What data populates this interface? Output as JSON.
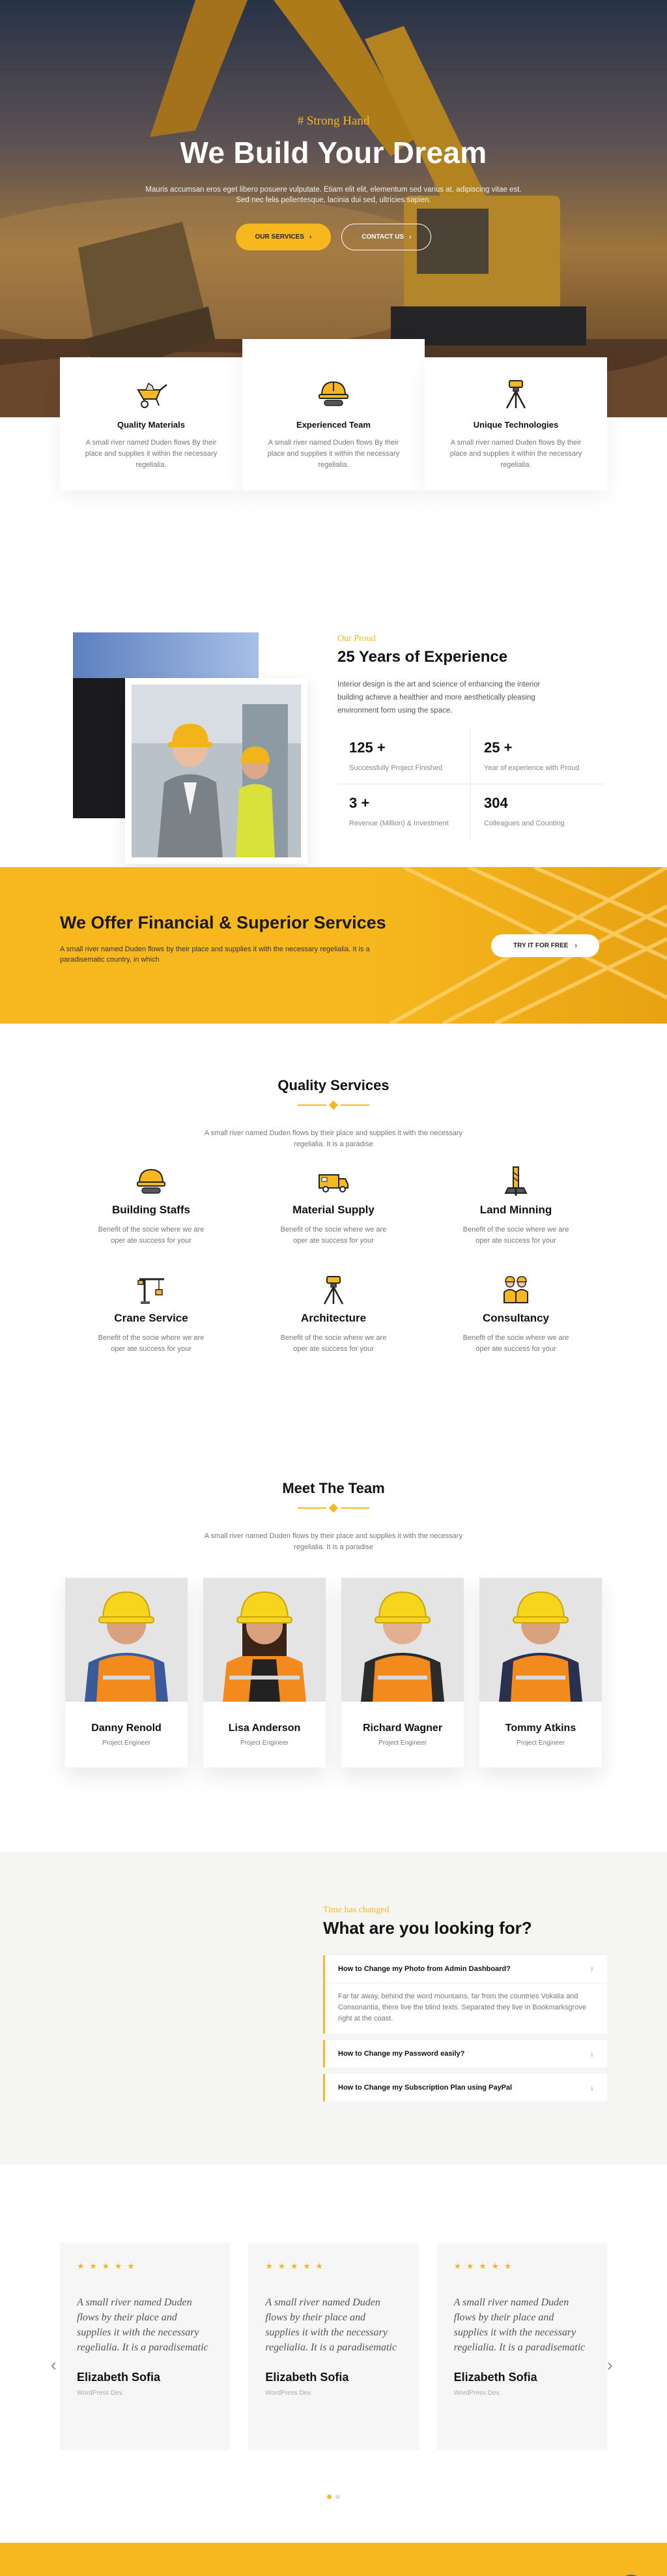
{
  "hero": {
    "kicker": "# Strong Hand",
    "title": "We Build Your Dream",
    "text": "Mauris accumsan eros eget libero posuere vulputate. Etiam elit elit, elementum sed varius at, adipiscing vitae est. Sed nec felis pellentesque, lacinia dui sed, ultricies sapien.",
    "btn_services": "OUR SERVICES",
    "btn_contact": "CONTACT US",
    "arrow": "›"
  },
  "features": [
    {
      "icon": "wheelbarrow-icon",
      "title": "Quality Materials",
      "text": "A small river named Duden flows By their place and supplies it within the necessary regelialia."
    },
    {
      "icon": "hardhat-icon",
      "title": "Experienced Team",
      "text": "A small river named Duden flows By their place and supplies it within the necessary regelialia."
    },
    {
      "icon": "survey-tripod-icon",
      "title": "Unique Technologies",
      "text": "A small river named Duden flows By their place and supplies it within the necessary regelialia."
    }
  ],
  "experience": {
    "kicker": "Our Proud",
    "title": "25 Years of Experience",
    "text": "Interior design is the art and science of enhancing the interior building achieve a healthier and more aesthetically pleasing environment form using the space.",
    "stats": [
      {
        "num": "125 +",
        "label": "Successfully Project Finished"
      },
      {
        "num": "25 +",
        "label": "Year of experience with Proud"
      },
      {
        "num": "3 +",
        "label": "Revenue (Million) & Investment"
      },
      {
        "num": "304",
        "label": "Colleagues and Counting"
      }
    ]
  },
  "cta": {
    "title": "We Offer Financial & Superior Services",
    "text": "A small river named Duden flows by their place and supplies it with the necessary regelialia. It is a paradisematic country, in which",
    "button": "TRY IT FOR FREE",
    "arrow": "›"
  },
  "services": {
    "title": "Quality Services",
    "text": "A small river named Duden flows by their place and supplies it with the necessary regelialia. It is a paradise",
    "items": [
      {
        "icon": "hardhat-icon",
        "title": "Building Staffs",
        "text": "Benefit of the socie where we are oper ate success for your"
      },
      {
        "icon": "truck-icon",
        "title": "Material Supply",
        "text": "Benefit of the socie where we are oper ate success for your"
      },
      {
        "icon": "drill-rig-icon",
        "title": "Land Minning",
        "text": "Benefit of the socie where we are oper ate success for your"
      },
      {
        "icon": "crane-icon",
        "title": "Crane Service",
        "text": "Benefit of the socie where we are oper ate success for your"
      },
      {
        "icon": "survey-tripod-icon",
        "title": "Architecture",
        "text": "Benefit of the socie where we are oper ate success for your"
      },
      {
        "icon": "workers-icon",
        "title": "Consultancy",
        "text": "Benefit of the socie where we are oper ate success for your"
      }
    ]
  },
  "team": {
    "title": "Meet The Team",
    "text": "A small river named Duden flows by their place and supplies it with the necessary regelialia. It is a paradise",
    "members": [
      {
        "name": "Danny Renold",
        "role": "Project Engineer",
        "shirt": "#3c5a9a"
      },
      {
        "name": "Lisa Anderson",
        "role": "Project Engineer",
        "shirt": "#f28a1e"
      },
      {
        "name": "Richard Wagner",
        "role": "Project Engineer",
        "shirt": "#2b2b2b"
      },
      {
        "name": "Tommy Atkins",
        "role": "Project Engineer",
        "shirt": "#2a3050"
      }
    ]
  },
  "faq": {
    "kicker": "Time has changed",
    "title": "What are you looking for?",
    "items": [
      {
        "q": "How to Change my Photo from Admin Dashboard?",
        "icon": "↑",
        "a": "Far far away, behind the word mountains, far from the countries Vokalia and Consonantia, there live the blind texts. Separated they live in Bookmarksgrove right at the coast."
      },
      {
        "q": "How to Change my Password easily?",
        "icon": "↓"
      },
      {
        "q": "How to Change my Subscription Plan using PayPal",
        "icon": "↓"
      }
    ]
  },
  "testimonials": {
    "items": [
      {
        "stars": "★ ★ ★ ★ ★",
        "quote": "A small river named Duden flows by their place and supplies it with the necessary regelialia. It is a paradisematic",
        "name": "Elizabeth Sofia",
        "role": "WordPress Dev."
      },
      {
        "stars": "★ ★ ★ ★ ★",
        "quote": "A small river named Duden flows by their place and supplies it with the necessary regelialia. It is a paradisematic",
        "name": "Elizabeth Sofia",
        "role": "WordPress Dev."
      },
      {
        "stars": "★ ★ ★ ★ ★",
        "quote": "A small river named Duden flows by their place and supplies it with the necessary regelialia. It is a paradisematic",
        "name": "Elizabeth Sofia",
        "role": "WordPress Dev."
      }
    ],
    "prev": "‹",
    "next": "›"
  },
  "colors": {
    "accent": "#f7b81f",
    "dark": "#111111",
    "chat": "#1771d4"
  }
}
